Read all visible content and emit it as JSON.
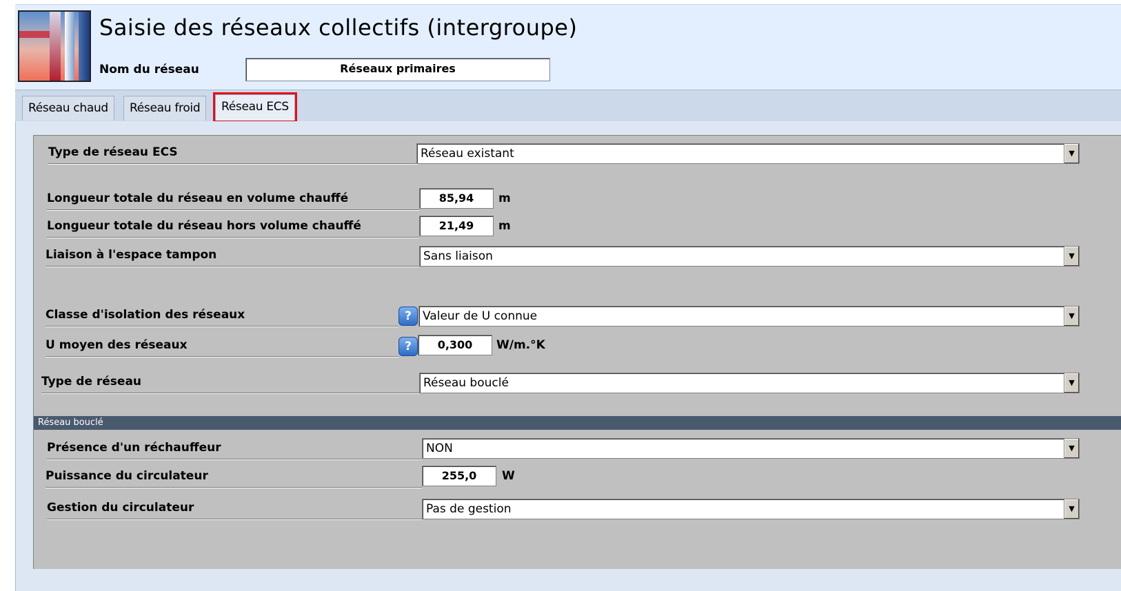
{
  "header": {
    "title": "Saisie des réseaux collectifs (intergroupe)",
    "name_label": "Nom du réseau",
    "name_value": "Réseaux primaires"
  },
  "tabs": [
    {
      "label": "Réseau chaud",
      "active": false
    },
    {
      "label": "Réseau froid",
      "active": false
    },
    {
      "label": "Réseau ECS",
      "active": true
    }
  ],
  "form": {
    "type_reseau_ecs": {
      "label": "Type de réseau ECS",
      "value": "Réseau existant"
    },
    "longueur_chauffe": {
      "label": "Longueur totale du réseau en volume chauffé",
      "value": "85,94",
      "unit": "m"
    },
    "longueur_hors": {
      "label": "Longueur totale du réseau hors volume chauffé",
      "value": "21,49",
      "unit": "m"
    },
    "liaison": {
      "label": "Liaison à l'espace tampon",
      "value": "Sans liaison"
    },
    "classe_isolation": {
      "label": "Classe d'isolation des réseaux",
      "value": "Valeur de U connue"
    },
    "u_moyen": {
      "label": "U moyen des réseaux",
      "value": "0,300",
      "unit": "W/m.°K"
    },
    "type_reseau": {
      "label": "Type de réseau",
      "value": "Réseau bouclé"
    }
  },
  "section": {
    "title": "Réseau bouclé",
    "rechauffeur": {
      "label": "Présence d'un réchauffeur",
      "value": "NON"
    },
    "puissance": {
      "label": "Puissance du circulateur",
      "value": "255,0",
      "unit": "W"
    },
    "gestion": {
      "label": "Gestion du circulateur",
      "value": "Pas de gestion"
    }
  },
  "icons": {
    "help": "help-icon",
    "dropdown": "dropdown-arrow-icon"
  },
  "colors": {
    "active_tab_highlight": "#e0101a",
    "section_bar": "#4a5a6e"
  }
}
